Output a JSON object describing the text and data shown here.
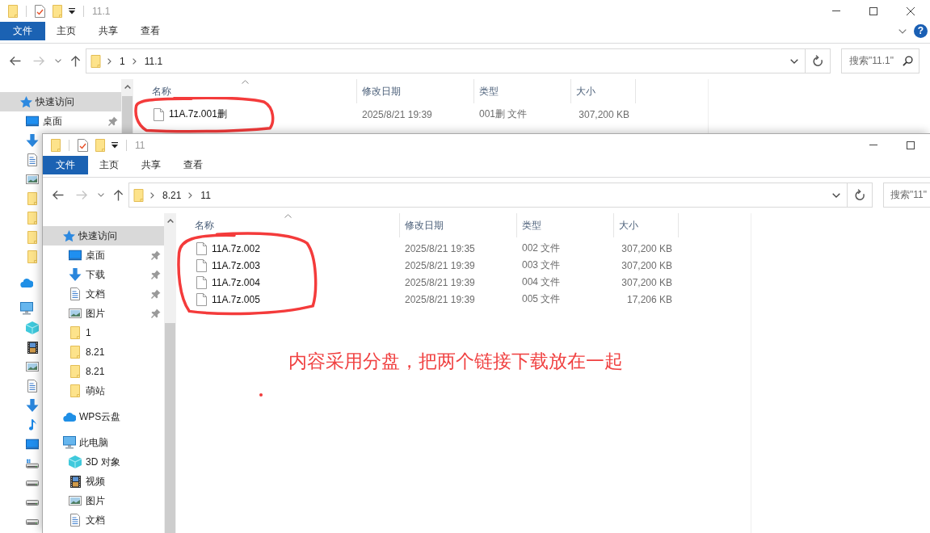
{
  "windows": [
    {
      "title": "11.1",
      "controls": [
        {
          "kind": "minimize"
        },
        {
          "kind": "maximize"
        },
        {
          "kind": "close"
        }
      ],
      "ribbon": {
        "tabs": [
          {
            "label": "文件",
            "kind": "file"
          },
          {
            "label": "主页",
            "kind": "tab"
          },
          {
            "label": "共享",
            "kind": "tab"
          },
          {
            "label": "查看",
            "kind": "tab"
          }
        ],
        "help": "?"
      },
      "nav_buttons": [
        {
          "kind": "back",
          "disabled": false
        },
        {
          "kind": "forward",
          "disabled": true
        },
        {
          "kind": "recent",
          "disabled": false
        },
        {
          "kind": "up",
          "disabled": false
        }
      ],
      "breadcrumb": [
        "1",
        "11.1"
      ],
      "search": {
        "placeholder": "搜索\"11.1\""
      },
      "nav_pane": {
        "items": [
          {
            "kind": "quick",
            "label": "快速访问",
            "selected": true,
            "children": [
              {
                "kind": "desktop",
                "label": "桌面",
                "pinned": true,
                "selected": false
              },
              {
                "kind": "downloads",
                "selected": false
              },
              {
                "kind": "documents",
                "selected": false
              },
              {
                "kind": "pictures",
                "selected": false
              },
              {
                "kind": "folder",
                "selected": false
              },
              {
                "kind": "folder",
                "selected": false
              },
              {
                "kind": "folder",
                "selected": false
              },
              {
                "kind": "folder",
                "selected": false
              }
            ]
          },
          {
            "kind": "cloud",
            "selected": false
          },
          {
            "kind": "computer",
            "selected": false,
            "children": [
              {
                "kind": "objects",
                "selected": false
              },
              {
                "kind": "videos",
                "selected": false
              },
              {
                "kind": "pictures",
                "selected": false
              },
              {
                "kind": "documents",
                "selected": false
              },
              {
                "kind": "downloads",
                "selected": false
              },
              {
                "kind": "music",
                "selected": false
              },
              {
                "kind": "desktop",
                "selected": false
              },
              {
                "kind": "systemdrive",
                "selected": false
              },
              {
                "kind": "drive",
                "selected": false
              },
              {
                "kind": "drive",
                "selected": false
              },
              {
                "kind": "drive",
                "selected": false
              }
            ]
          }
        ]
      },
      "file_list": {
        "columns": [
          {
            "label": "名称",
            "sorted": true
          },
          {
            "label": "修改日期",
            "sorted": false
          },
          {
            "label": "类型",
            "sorted": false
          },
          {
            "label": "大小",
            "sorted": false
          }
        ],
        "rows": [
          {
            "name": "11A.7z.001删",
            "modified": "2025/8/21 19:39",
            "type": "001删 文件",
            "size": "307,200 KB"
          }
        ],
        "circled": true
      }
    },
    {
      "title": "11",
      "controls": [
        {
          "kind": "minimize"
        },
        {
          "kind": "maximize"
        }
      ],
      "ribbon": {
        "tabs": [
          {
            "label": "文件",
            "kind": "file"
          },
          {
            "label": "主页",
            "kind": "tab"
          },
          {
            "label": "共享",
            "kind": "tab"
          },
          {
            "label": "查看",
            "kind": "tab"
          }
        ]
      },
      "nav_buttons": [
        {
          "kind": "back",
          "disabled": false
        },
        {
          "kind": "forward",
          "disabled": true
        },
        {
          "kind": "recent",
          "disabled": false
        },
        {
          "kind": "up",
          "disabled": false
        }
      ],
      "breadcrumb": [
        "8.21",
        "11"
      ],
      "search": {
        "placeholder": "搜索\"11\""
      },
      "nav_pane": {
        "items": [
          {
            "kind": "quick",
            "label": "快速访问",
            "selected": true,
            "children": [
              {
                "kind": "desktop",
                "label": "桌面",
                "pinned": true,
                "selected": false
              },
              {
                "kind": "downloads",
                "label": "下载",
                "pinned": true,
                "selected": false
              },
              {
                "kind": "documents",
                "label": "文档",
                "pinned": true,
                "selected": false
              },
              {
                "kind": "pictures",
                "label": "图片",
                "pinned": true,
                "selected": false
              },
              {
                "kind": "folder",
                "label": "1",
                "pinned": false,
                "selected": false
              },
              {
                "kind": "folder",
                "label": "8.21",
                "pinned": false,
                "selected": false
              },
              {
                "kind": "folder",
                "label": "8.21",
                "pinned": false,
                "selected": false
              },
              {
                "kind": "folder",
                "label": "萌站",
                "pinned": false,
                "selected": false
              }
            ]
          },
          {
            "kind": "cloud",
            "label": "WPS云盘",
            "selected": false
          },
          {
            "kind": "computer",
            "label": "此电脑",
            "selected": false,
            "children": [
              {
                "kind": "objects",
                "label": "3D 对象",
                "selected": false
              },
              {
                "kind": "videos",
                "label": "视频",
                "selected": false
              },
              {
                "kind": "pictures",
                "label": "图片",
                "selected": false
              },
              {
                "kind": "documents",
                "label": "文档",
                "selected": false
              }
            ]
          }
        ]
      },
      "file_list": {
        "columns": [
          {
            "label": "名称",
            "sorted": true
          },
          {
            "label": "修改日期",
            "sorted": false
          },
          {
            "label": "类型",
            "sorted": false
          },
          {
            "label": "大小",
            "sorted": false
          }
        ],
        "rows": [
          {
            "name": "11A.7z.002",
            "modified": "2025/8/21 19:35",
            "type": "002 文件",
            "size": "307,200 KB"
          },
          {
            "name": "11A.7z.003",
            "modified": "2025/8/21 19:39",
            "type": "003 文件",
            "size": "307,200 KB"
          },
          {
            "name": "11A.7z.004",
            "modified": "2025/8/21 19:39",
            "type": "004 文件",
            "size": "307,200 KB"
          },
          {
            "name": "11A.7z.005",
            "modified": "2025/8/21 19:39",
            "type": "005 文件",
            "size": "17,206 KB"
          }
        ],
        "circled": true
      }
    }
  ],
  "note": {
    "text": "内容采用分盘，把两个链接下载放在一起",
    "dot": true
  }
}
